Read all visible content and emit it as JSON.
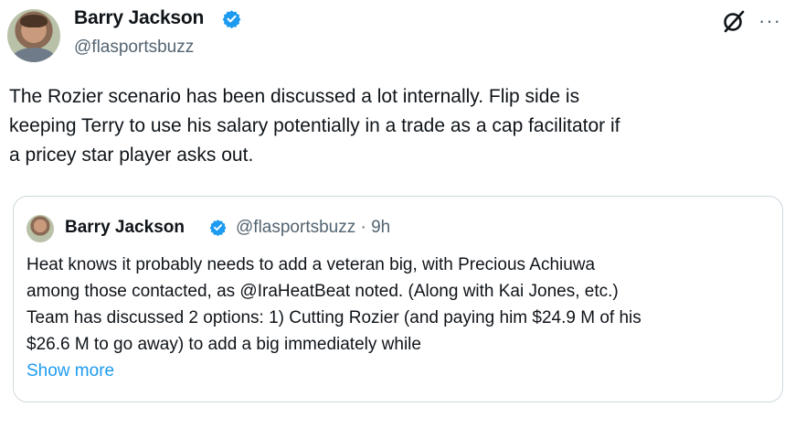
{
  "author": {
    "name": "Barry Jackson",
    "handle": "@flasportsbuzz"
  },
  "tweet": {
    "lines": [
      "The Rozier scenario has been discussed a lot internally. Flip side is",
      "keeping Terry to use his salary potentially in a trade as a cap facilitator if",
      "a pricey star player asks out."
    ]
  },
  "quoted": {
    "name": "Barry Jackson",
    "handle_time": "@flasportsbuzz · 9h",
    "lines": [
      "Heat knows it probably needs to add a veteran big, with Precious Achiuwa",
      "among those contacted, as @IraHeatBeat noted. (Along with Kai Jones, etc.)",
      "Team has discussed 2 options: 1) Cutting Rozier (and paying him $24.9 M of his",
      "$26.6 M to go away) to add a big immediately while"
    ],
    "show_more": "Show more"
  },
  "icons": {
    "verified": "verified-badge-icon",
    "grok": "grok-icon",
    "more": "more-options-icon"
  },
  "colors": {
    "verified": "#1d9bf0",
    "link": "#1d9bf0",
    "secondary_text": "#536471"
  }
}
